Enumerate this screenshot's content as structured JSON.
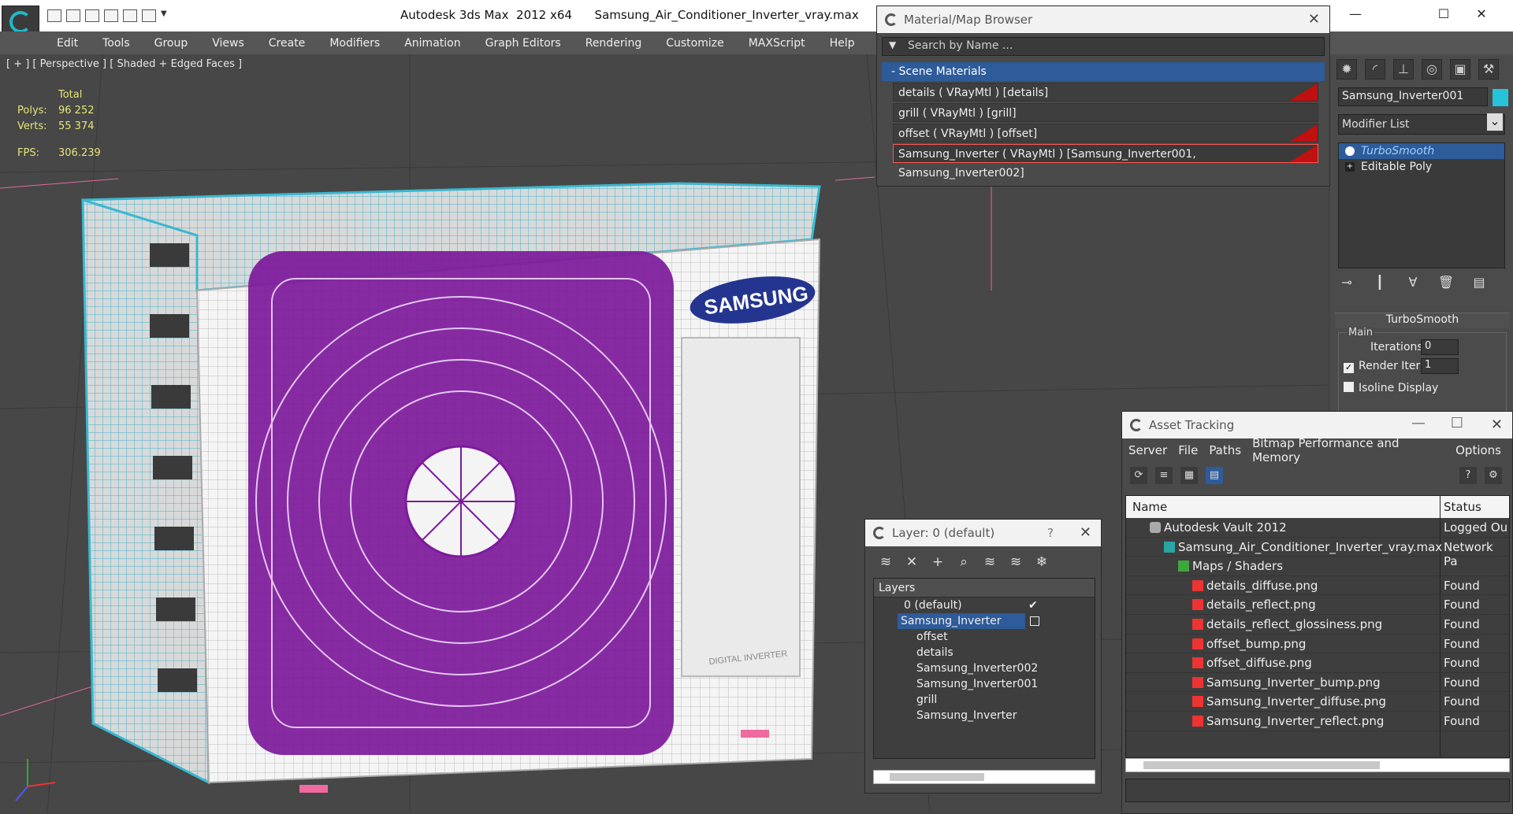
{
  "window": {
    "title": "Autodesk 3ds Max  2012 x64      Samsung_Air_Conditioner_Inverter_vray.max",
    "controls": [
      "—",
      "☐",
      "✕"
    ]
  },
  "menu": [
    "Edit",
    "Tools",
    "Group",
    "Views",
    "Create",
    "Modifiers",
    "Animation",
    "Graph Editors",
    "Rendering",
    "Customize",
    "MAXScript",
    "Help"
  ],
  "viewport": {
    "label": "[ + ] [ Perspective ] [ Shaded + Edged Faces ]",
    "stats": {
      "total_label": "Total",
      "polys_label": "Polys:",
      "polys": "96 252",
      "verts_label": "Verts:",
      "verts": "55 374",
      "fps_label": "FPS:",
      "fps": "306.239"
    },
    "logo_text": "SAMSUNG",
    "sticker_text": "DIGITAL INVERTER"
  },
  "material_browser": {
    "title": "Material/Map Browser",
    "search_placeholder": "Search by Name ...",
    "section": "- Scene Materials",
    "items": [
      "details  ( VRayMtl )  [details]",
      "grill  ( VRayMtl )  [grill]",
      "offset  ( VRayMtl )  [offset]",
      "Samsung_Inverter  ( VRayMtl )  [Samsung_Inverter001, Samsung_Inverter002]"
    ]
  },
  "command_panel": {
    "object_name": "Samsung_Inverter001",
    "object_color": "#26c4d8",
    "modifier_list": "Modifier List",
    "stack": [
      "TurboSmooth",
      "Editable Poly"
    ],
    "rollout": "TurboSmooth",
    "group": "Main",
    "iterations_label": "Iterations:",
    "iterations": "0",
    "render_iters_label": "Render Iters:",
    "render_iters": "1",
    "isoline_label": "Isoline Display"
  },
  "layer_window": {
    "title": "Layer: 0 (default)",
    "help": "?",
    "header": "Layers",
    "layers": [
      "0 (default)",
      "Samsung_Inverter",
      "offset",
      "details",
      "Samsung_Inverter002",
      "Samsung_Inverter001",
      "grill",
      "Samsung_Inverter"
    ]
  },
  "asset_tracking": {
    "title": "Asset Tracking",
    "menu": [
      "Server",
      "File",
      "Paths",
      "Bitmap Performance and Memory",
      "Options"
    ],
    "col_name": "Name",
    "col_status": "Status",
    "rows": [
      {
        "name": "Autodesk Vault 2012",
        "status": "Logged Ou"
      },
      {
        "name": "Samsung_Air_Conditioner_Inverter_vray.max",
        "status": "Network Pa"
      },
      {
        "name": "Maps / Shaders",
        "status": ""
      },
      {
        "name": "details_diffuse.png",
        "status": "Found"
      },
      {
        "name": "details_reflect.png",
        "status": "Found"
      },
      {
        "name": "details_reflect_glossiness.png",
        "status": "Found"
      },
      {
        "name": "offset_bump.png",
        "status": "Found"
      },
      {
        "name": "offset_diffuse.png",
        "status": "Found"
      },
      {
        "name": "Samsung_Inverter_bump.png",
        "status": "Found"
      },
      {
        "name": "Samsung_Inverter_diffuse.png",
        "status": "Found"
      },
      {
        "name": "Samsung_Inverter_reflect.png",
        "status": "Found"
      }
    ]
  }
}
